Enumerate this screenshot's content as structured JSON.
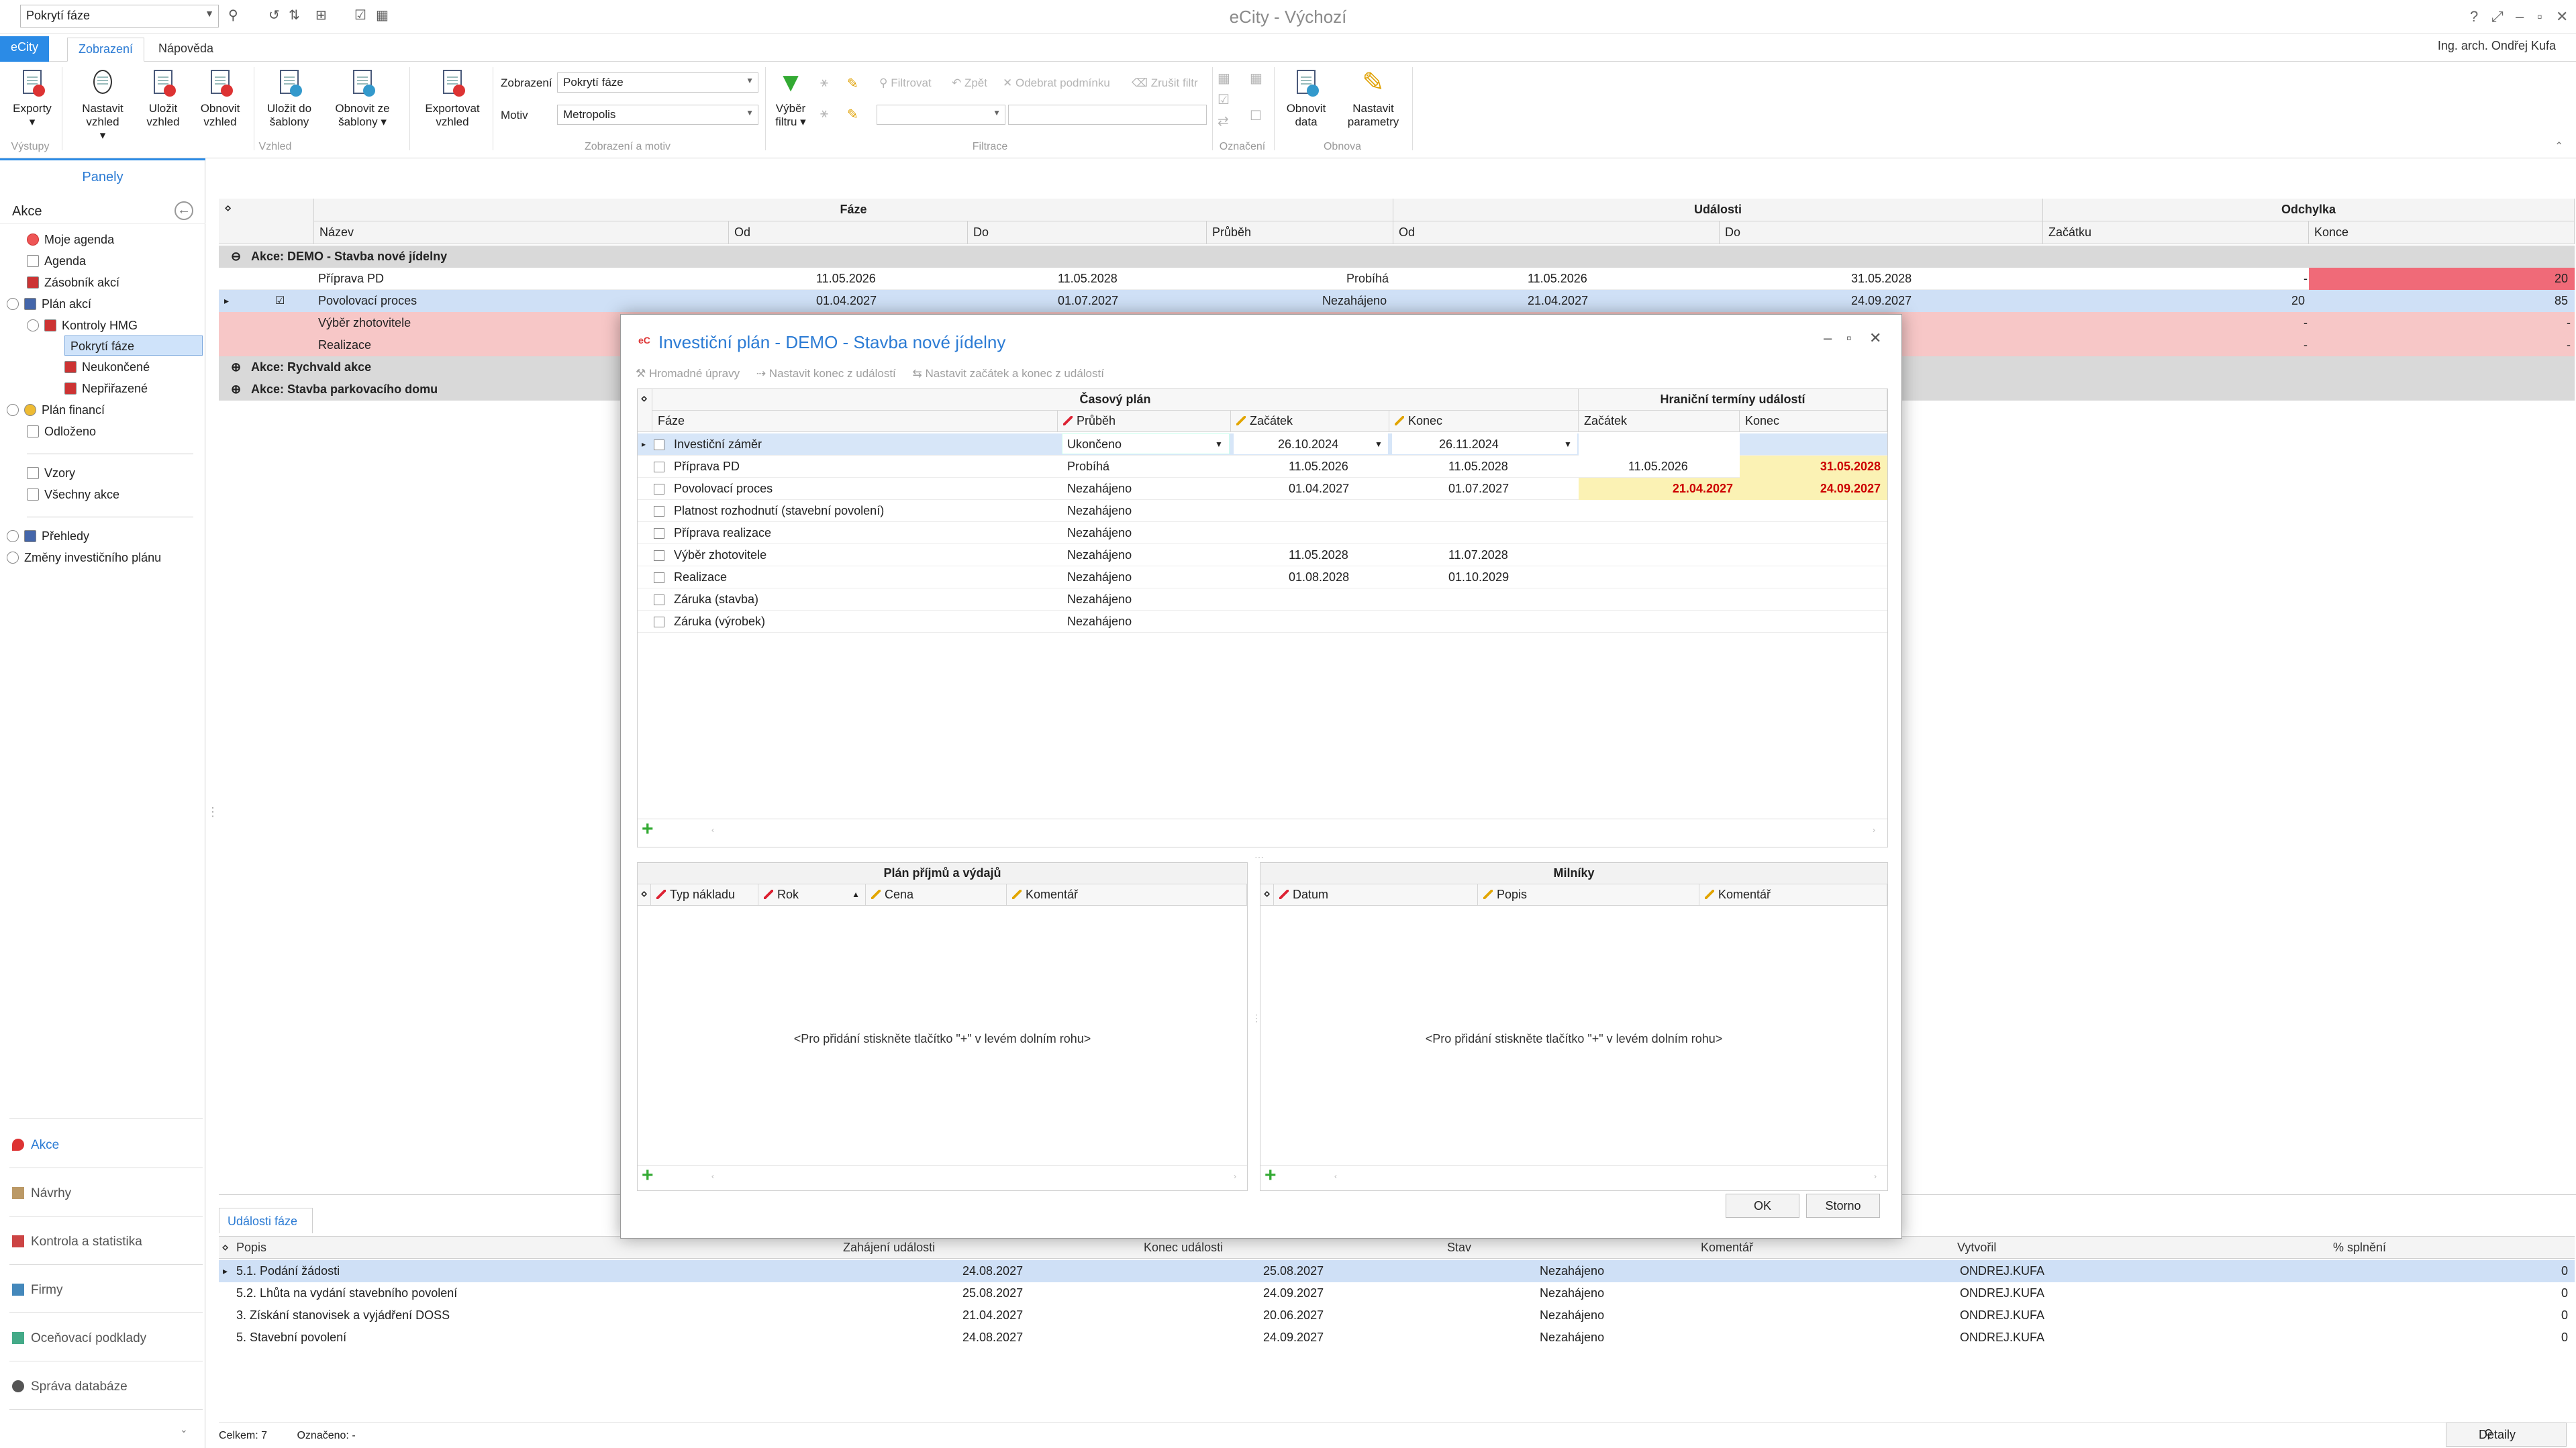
{
  "titlebar": {
    "view_combo": "Pokrytí fáze",
    "app_title": "eCity - Výchozí"
  },
  "ribbon_tabs": {
    "file": "eCity",
    "view": "Zobrazení",
    "help": "Nápověda"
  },
  "user": "Ing. arch. Ondřej Kufa",
  "ribbon": {
    "exports": "Exporty",
    "set_view": "Nastavit vzhled",
    "save_view": "Uložit vzhled",
    "refresh_view": "Obnovit vzhled",
    "save_template": "Uložit do šablony",
    "restore_template": "Obnovit ze šablony",
    "export_view": "Exportovat vzhled",
    "display_label": "Zobrazení",
    "display_value": "Pokrytí fáze",
    "motif_label": "Motiv",
    "motif_value": "Metropolis",
    "filter_select": "Výběr filtru",
    "filter": "Filtrovat",
    "back": "Zpět",
    "remove_cond": "Odebrat podmínku",
    "cancel_filter": "Zrušit filtr",
    "refresh_data": "Obnovit data",
    "set_params": "Nastavit parametry",
    "group_outputs": "Výstupy",
    "group_view": "Vzhled",
    "group_display": "Zobrazení a motiv",
    "group_filter": "Filtrace",
    "group_mark": "Označení",
    "group_refresh": "Obnova"
  },
  "left_panel": {
    "header": "Panely",
    "section": "Akce",
    "items": [
      "Moje agenda",
      "Agenda",
      "Zásobník akcí",
      "Plán akcí",
      "Kontroly HMG",
      "Pokrytí fáze",
      "Neukončené",
      "Nepřiřazené",
      "Plán financí",
      "Odloženo",
      "Vzory",
      "Všechny akce",
      "Přehledy",
      "Změny investičního plánu"
    ],
    "bottom": [
      "Akce",
      "Návrhy",
      "Kontrola a statistika",
      "Firmy",
      "Oceňovací podklady",
      "Správa databáze"
    ]
  },
  "grid": {
    "bands": [
      "Fáze",
      "Události",
      "Odchylka"
    ],
    "columns": [
      "Název",
      "Od",
      "Do",
      "Průběh",
      "Od",
      "Do",
      "Začátku",
      "Konce"
    ],
    "groups": [
      "Akce: DEMO - Stavba nové jídelny",
      "Akce: Rychvald akce",
      "Akce: Stavba parkovacího domu"
    ],
    "rows": [
      {
        "name": "Příprava PD",
        "od": "11.05.2026",
        "do": "11.05.2028",
        "prubeh": "Probíhá",
        "eod": "11.05.2026",
        "edo": "31.05.2028",
        "zac": "-",
        "kon": "20"
      },
      {
        "name": "Povolovací proces",
        "od": "01.04.2027",
        "do": "01.07.2027",
        "prubeh": "Nezahájeno",
        "eod": "21.04.2027",
        "edo": "24.09.2027",
        "zac": "20",
        "kon": "85"
      },
      {
        "name": "Výběr zhotovitele",
        "od": "",
        "do": "",
        "prubeh": "",
        "eod": "",
        "edo": "",
        "zac": "-",
        "kon": "-"
      },
      {
        "name": "Realizace",
        "od": "",
        "do": "",
        "prubeh": "",
        "eod": "",
        "edo": "",
        "zac": "-",
        "kon": "-"
      }
    ]
  },
  "dialog": {
    "title": "Investiční plán - DEMO - Stavba nové jídelny",
    "toolbar": [
      "Hromadné úpravy",
      "Nastavit konec z událostí",
      "Nastavit začátek a konec z událostí"
    ],
    "band_plan": "Časový plán",
    "band_events": "Hraniční termíny událostí",
    "cols": [
      "Fáze",
      "Průběh",
      "Začátek",
      "Konec",
      "Začátek",
      "Konec"
    ],
    "rows": [
      {
        "faze": "Investiční záměr",
        "prubeh": "Ukončeno",
        "zac": "26.10.2024",
        "kon": "26.11.2024",
        "ez": "",
        "ek": ""
      },
      {
        "faze": "Příprava PD",
        "prubeh": "Probíhá",
        "zac": "11.05.2026",
        "kon": "11.05.2028",
        "ez": "11.05.2026",
        "ek": "31.05.2028"
      },
      {
        "faze": "Povolovací proces",
        "prubeh": "Nezahájeno",
        "zac": "01.04.2027",
        "kon": "01.07.2027",
        "ez": "21.04.2027",
        "ek": "24.09.2027"
      },
      {
        "faze": "Platnost rozhodnutí (stavební povolení)",
        "prubeh": "Nezahájeno",
        "zac": "",
        "kon": "",
        "ez": "",
        "ek": ""
      },
      {
        "faze": "Příprava realizace",
        "prubeh": "Nezahájeno",
        "zac": "",
        "kon": "",
        "ez": "",
        "ek": ""
      },
      {
        "faze": "Výběr zhotovitele",
        "prubeh": "Nezahájeno",
        "zac": "11.05.2028",
        "kon": "11.07.2028",
        "ez": "",
        "ek": ""
      },
      {
        "faze": "Realizace",
        "prubeh": "Nezahájeno",
        "zac": "01.08.2028",
        "kon": "01.10.2029",
        "ez": "",
        "ek": ""
      },
      {
        "faze": "Záruka (stavba)",
        "prubeh": "Nezahájeno",
        "zac": "",
        "kon": "",
        "ez": "",
        "ek": ""
      },
      {
        "faze": "Záruka (výrobek)",
        "prubeh": "Nezahájeno",
        "zac": "",
        "kon": "",
        "ez": "",
        "ek": ""
      }
    ],
    "budget_title": "Plán příjmů a výdajů",
    "budget_cols": [
      "Typ nákladu",
      "Rok",
      "Cena",
      "Komentář"
    ],
    "milestones_title": "Milníky",
    "milestones_cols": [
      "Datum",
      "Popis",
      "Komentář"
    ],
    "empty_hint": "<Pro přidání stiskněte tlačítko \"+\" v levém dolním rohu>",
    "ok": "OK",
    "cancel": "Storno"
  },
  "events": {
    "tab": "Události fáze",
    "columns": [
      "Popis",
      "Zahájení události",
      "Konec události",
      "Stav",
      "Komentář",
      "Vytvořil",
      "% splnění"
    ],
    "rows": [
      {
        "popis": "5.1. Podání žádosti",
        "zah": "24.08.2027",
        "kon": "25.08.2027",
        "stav": "Nezahájeno",
        "kom": "",
        "vyt": "ONDREJ.KUFA",
        "spl": "0"
      },
      {
        "popis": "5.2. Lhůta na vydání stavebního povolení",
        "zah": "25.08.2027",
        "kon": "24.09.2027",
        "stav": "Nezahájeno",
        "kom": "",
        "vyt": "ONDREJ.KUFA",
        "spl": "0"
      },
      {
        "popis": "3. Získání stanovisek a vyjádření DOSS",
        "zah": "21.04.2027",
        "kon": "20.06.2027",
        "stav": "Nezahájeno",
        "kom": "",
        "vyt": "ONDREJ.KUFA",
        "spl": "0"
      },
      {
        "popis": "5. Stavební povolení",
        "zah": "24.08.2027",
        "kon": "24.09.2027",
        "stav": "Nezahájeno",
        "kom": "",
        "vyt": "ONDREJ.KUFA",
        "spl": "0"
      }
    ]
  },
  "status": {
    "total": "Celkem: 7",
    "marked": "Označeno: -",
    "details": "Detaily"
  },
  "colors": {
    "accent": "#2b8be6",
    "group_bg": "#d9d9d9",
    "pink": "#f7c7c7",
    "deviation_red": "#f06a78",
    "highlight": "#fbf2b4"
  }
}
